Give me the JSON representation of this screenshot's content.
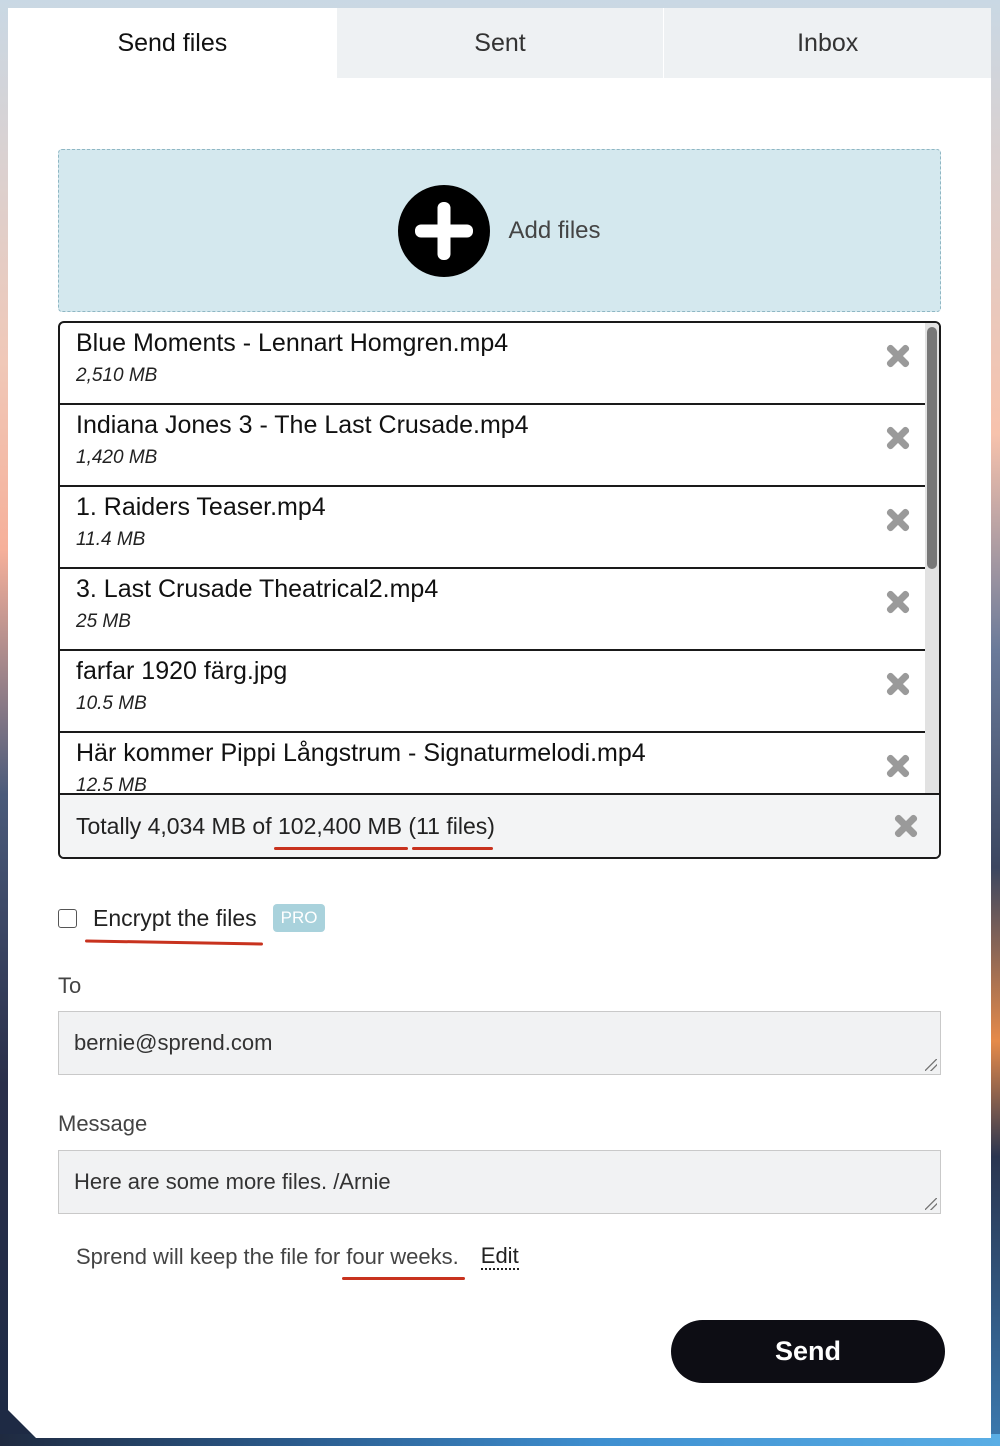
{
  "tabs": [
    {
      "label": "Send files",
      "active": true
    },
    {
      "label": "Sent",
      "active": false
    },
    {
      "label": "Inbox",
      "active": false
    }
  ],
  "dropzone": {
    "label": "Add files",
    "icon": "plus-circle-icon"
  },
  "files": [
    {
      "name": "Blue Moments - Lennart Homgren.mp4",
      "size": "2,510 MB"
    },
    {
      "name": "Indiana Jones 3 - The Last Crusade.mp4",
      "size": "1,420 MB"
    },
    {
      "name": "1. Raiders Teaser.mp4",
      "size": "11.4 MB"
    },
    {
      "name": "3. Last Crusade Theatrical2.mp4",
      "size": "25 MB"
    },
    {
      "name": "farfar 1920 färg.jpg",
      "size": "10.5 MB"
    },
    {
      "name": "Här kommer Pippi Långstrum - Signaturmelodi.mp4",
      "size": "12.5 MB"
    }
  ],
  "totals": {
    "prefix": "Totally 4,034 MB of ",
    "limit": "102,400 MB",
    "open_paren": " (",
    "count": "11 files",
    "close_paren": ")"
  },
  "encrypt": {
    "label": "Encrypt the files",
    "badge": "PRO",
    "checked": false
  },
  "to": {
    "label": "To",
    "value": "bernie@sprend.com"
  },
  "message": {
    "label": "Message",
    "value": "Here are some more files. /Arnie"
  },
  "retention": {
    "prefix": "Sprend will keep the file for ",
    "period": "four weeks.",
    "edit_label": "Edit"
  },
  "send_button": {
    "label": "Send"
  },
  "colors": {
    "accent": "#d4e8ee",
    "annotation": "#c8321e",
    "send": "#0d0d14",
    "badge": "#a9d2dc"
  }
}
